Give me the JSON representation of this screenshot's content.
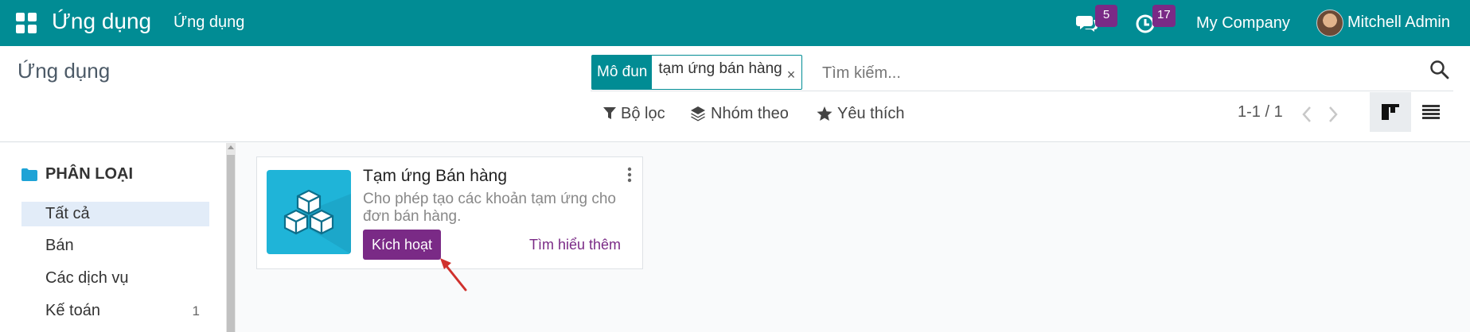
{
  "topbar": {
    "brand": "Ứng dụng",
    "menu_link": "Ứng dụng",
    "messages_badge": "5",
    "activities_badge": "17",
    "company": "My Company",
    "user": "Mitchell Admin"
  },
  "control": {
    "title": "Ứng dụng",
    "facet_label": "Mô đun",
    "facet_value": "tạm ứng bán hàng",
    "facet_close": "×",
    "search_placeholder": "Tìm kiếm...",
    "filter_label": "Bộ lọc",
    "group_label": "Nhóm theo",
    "favorite_label": "Yêu thích",
    "pager": "1-1 / 1"
  },
  "sidebar": {
    "heading": "PHÂN LOẠI",
    "items": [
      {
        "label": "Tất cả",
        "count": ""
      },
      {
        "label": "Bán",
        "count": ""
      },
      {
        "label": "Các dịch vụ",
        "count": ""
      },
      {
        "label": "Kế toán",
        "count": "1"
      }
    ]
  },
  "card": {
    "name": "Tạm ứng Bán hàng",
    "description": "Cho phép tạo các khoản tạm ứng cho đơn bán hàng.",
    "activate_label": "Kích hoạt",
    "learn_more_label": "Tìm hiểu thêm"
  },
  "colors": {
    "topbar": "#018c94",
    "primary": "#7a2a86",
    "app_icon": "#1fb4d8",
    "annotation_arrow": "#d0312d"
  }
}
